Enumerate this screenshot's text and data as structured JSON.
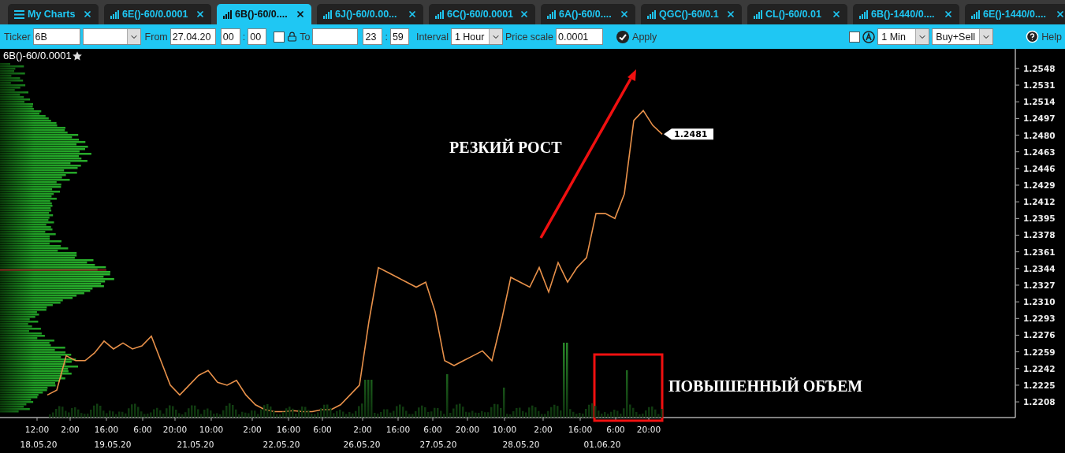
{
  "tabs": [
    {
      "kind": "menu",
      "label": "My Charts",
      "selected": false
    },
    {
      "kind": "chart",
      "label": "6E()-60/0.0001",
      "selected": false
    },
    {
      "kind": "chart",
      "label": "6B()-60/0....",
      "selected": true
    },
    {
      "kind": "chart",
      "label": "6J()-60/0.00...",
      "selected": false
    },
    {
      "kind": "chart",
      "label": "6C()-60/0.0001",
      "selected": false
    },
    {
      "kind": "chart",
      "label": "6A()-60/0....",
      "selected": false
    },
    {
      "kind": "chart",
      "label": "QGC()-60/0.1",
      "selected": false
    },
    {
      "kind": "chart",
      "label": "CL()-60/0.01",
      "selected": false
    },
    {
      "kind": "chart",
      "label": "6B()-1440/0....",
      "selected": false
    },
    {
      "kind": "chart",
      "label": "6E()-1440/0....",
      "selected": false
    }
  ],
  "toolbar": {
    "ticker_label": "Ticker",
    "ticker_value": "6B",
    "from_label": "From",
    "from_date": "27.04.20",
    "from_hour": "00",
    "from_separator": ":",
    "from_minute": "00",
    "lock_checked": false,
    "to_label": "To",
    "to_hour": "23",
    "to_separator": ":",
    "to_minute": "59",
    "interval_label": "Interval",
    "interval_value": "1 Hour",
    "price_scale_label": "Price scale",
    "price_scale_value": "0.0001",
    "apply_label": "Apply",
    "auto_checked": false,
    "timeframe_value": "1 Min",
    "side_value": "Buy+Sell",
    "help_label": "Help"
  },
  "chart": {
    "legend": "6B()-60/0.0001",
    "last_price": "1.2481",
    "chart_data": {
      "type": "line",
      "ylim": [
        1.2192,
        1.2568
      ],
      "series": [
        {
          "color": "#e8914a",
          "values": [
            1.2215,
            1.222,
            1.2255,
            1.225,
            1.225,
            1.2258,
            1.227,
            1.2262,
            1.2268,
            1.2262,
            1.2265,
            1.2275,
            1.225,
            1.2225,
            1.2215,
            1.2225,
            1.2235,
            1.224,
            1.2228,
            1.2225,
            1.223,
            1.2215,
            1.2205,
            1.22,
            1.2198,
            1.2198,
            1.2199,
            1.2198,
            1.2198,
            1.22,
            1.22,
            1.2205,
            1.2215,
            1.2225,
            1.229,
            1.2345,
            1.234,
            1.2335,
            1.233,
            1.2325,
            1.233,
            1.23,
            1.225,
            1.2245,
            1.225,
            1.2255,
            1.226,
            1.225,
            1.229,
            1.2335,
            1.233,
            1.2325,
            1.2345,
            1.232,
            1.235,
            1.233,
            1.2345,
            1.2355,
            1.24,
            1.24,
            1.2395,
            1.242,
            1.2495,
            1.2505,
            1.249,
            1.2481
          ]
        }
      ],
      "yticks": [
        {
          "value": 1.2548,
          "label": "1.2548"
        },
        {
          "value": 1.2531,
          "label": "1.2531"
        },
        {
          "value": 1.2514,
          "label": "1.2514"
        },
        {
          "value": 1.2497,
          "label": "1.2497"
        },
        {
          "value": 1.248,
          "label": "1.2480"
        },
        {
          "value": 1.2463,
          "label": "1.2463"
        },
        {
          "value": 1.2446,
          "label": "1.2446"
        },
        {
          "value": 1.2429,
          "label": "1.2429"
        },
        {
          "value": 1.2412,
          "label": "1.2412"
        },
        {
          "value": 1.2395,
          "label": "1.2395"
        },
        {
          "value": 1.2378,
          "label": "1.2378"
        },
        {
          "value": 1.2361,
          "label": "1.2361"
        },
        {
          "value": 1.2344,
          "label": "1.2344"
        },
        {
          "value": 1.2327,
          "label": "1.2327"
        },
        {
          "value": 1.231,
          "label": "1.2310"
        },
        {
          "value": 1.2293,
          "label": "1.2293"
        },
        {
          "value": 1.2276,
          "label": "1.2276"
        },
        {
          "value": 1.2259,
          "label": "1.2259"
        },
        {
          "value": 1.2242,
          "label": "1.2242"
        },
        {
          "value": 1.2225,
          "label": "1.2225"
        },
        {
          "value": 1.2208,
          "label": "1.2208"
        }
      ],
      "annotations": [
        {
          "text": "РЕЗКИЙ РОСТ"
        },
        {
          "text": "ПОВЫШЕННЫЙ ОБЪЕМ"
        }
      ]
    },
    "time_labels": [
      "12:00",
      "2:00",
      "16:00",
      "6:00",
      "20:00",
      "10:00",
      "2:00",
      "16:00",
      "6:00",
      "2:00",
      "16:00",
      "6:00",
      "20:00",
      "10:00",
      "2:00",
      "16:00",
      "6:00",
      "20:00"
    ],
    "date_labels": [
      "18.05.20",
      "19.05.20",
      "21.05.20",
      "22.05.20",
      "26.05.20",
      "27.05.20",
      "28.05.20",
      "01.06.20"
    ]
  }
}
